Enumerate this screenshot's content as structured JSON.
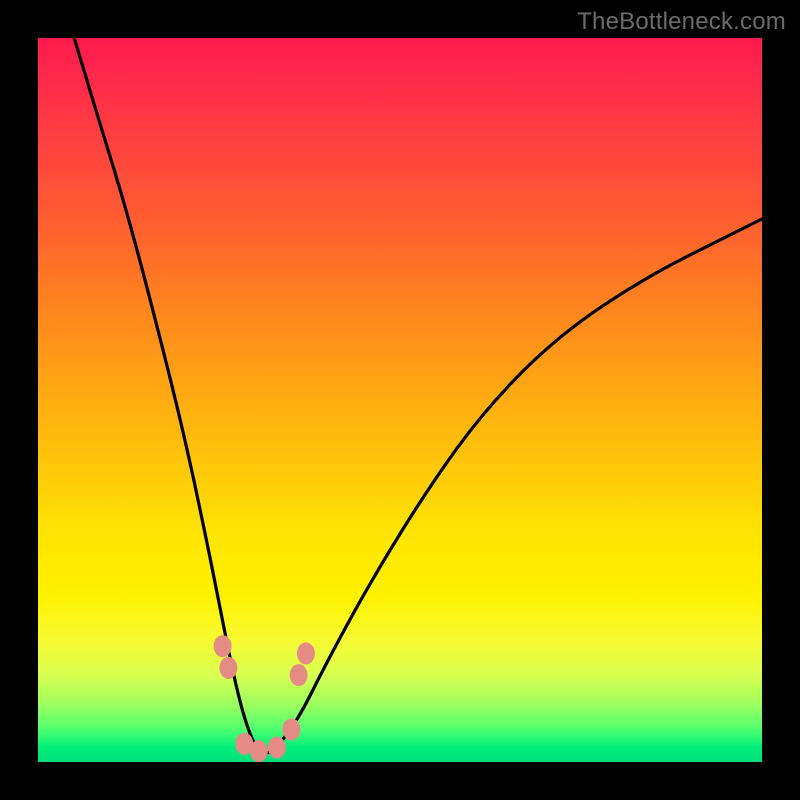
{
  "watermark": "TheBottleneck.com",
  "chart_data": {
    "type": "line",
    "title": "",
    "xlabel": "",
    "ylabel": "",
    "xlim": [
      0,
      100
    ],
    "ylim": [
      0,
      100
    ],
    "grid": false,
    "legend": false,
    "series": [
      {
        "name": "bottleneck-curve",
        "x": [
          5,
          8,
          12,
          16,
          20,
          23,
          25,
          27,
          28.5,
          30,
          31.5,
          33,
          36,
          40,
          46,
          54,
          62,
          72,
          84,
          96,
          100
        ],
        "y": [
          100,
          90,
          77,
          62,
          46,
          32,
          22,
          12,
          6,
          2,
          1,
          2,
          6,
          14,
          25,
          38,
          49,
          59,
          67,
          73,
          75
        ]
      }
    ],
    "markers": [
      {
        "name": "left-upper-tick",
        "x": 25.5,
        "y": 16
      },
      {
        "name": "left-lower-tick",
        "x": 26.3,
        "y": 13
      },
      {
        "name": "valley-left-dot",
        "x": 28.5,
        "y": 2.5
      },
      {
        "name": "valley-mid-dot",
        "x": 30.5,
        "y": 1.5
      },
      {
        "name": "valley-right-dot",
        "x": 33.0,
        "y": 2.0
      },
      {
        "name": "valley-far-right",
        "x": 35.0,
        "y": 4.5
      },
      {
        "name": "right-lower-tick",
        "x": 36.0,
        "y": 12
      },
      {
        "name": "right-upper-tick",
        "x": 37.0,
        "y": 15
      }
    ],
    "gradient_stops": [
      {
        "pos": 0.0,
        "color": "#ff1a4d"
      },
      {
        "pos": 0.34,
        "color": "#ff7a22"
      },
      {
        "pos": 0.68,
        "color": "#ffe305"
      },
      {
        "pos": 0.92,
        "color": "#9cff5e"
      },
      {
        "pos": 1.0,
        "color": "#00e07c"
      }
    ]
  }
}
